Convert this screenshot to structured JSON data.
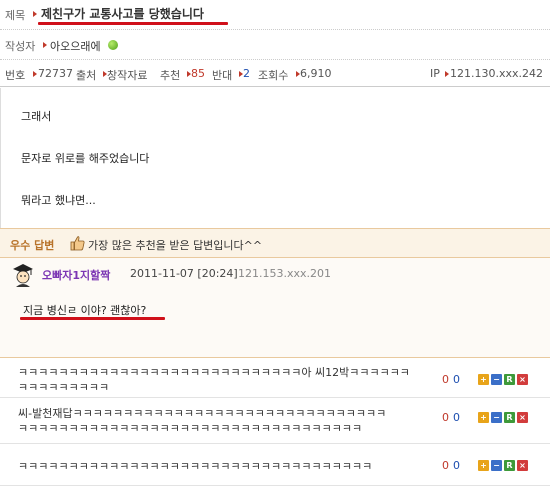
{
  "header": {
    "title_label": "제목",
    "title": "제친구가 교통사고를 당했습니다",
    "author_label": "작성자",
    "author": "아오으래에"
  },
  "meta": {
    "no_label": "번호",
    "no_value": "72737",
    "source_label": "출처",
    "source_value": "창작자료",
    "recommend_label": "추천",
    "recommend_value": "85",
    "oppose_label": "반대",
    "oppose_value": "2",
    "views_label": "조회수",
    "views_value": "6,910",
    "ip_label": "IP",
    "ip_value": "121.130.xxx.242"
  },
  "content": {
    "lines": [
      "그래서",
      "문자로 위로를 해주었습니다",
      "뭐라고 했냐면..."
    ]
  },
  "best_answer": {
    "label": "우수 답변",
    "description": "가장 많은 추천을 받은 답변입니다^^",
    "author": "오빠자1지할짝",
    "date": "2011-11-07 [20:24]",
    "ip": "121.153.xxx.201",
    "comment": "지금 병신ㄹ 이야? 괜찮아?"
  },
  "comments": [
    {
      "lines": [
        "ㅋㅋㅋㅋㅋㅋㅋㅋㅋㅋㅋㅋㅋㅋㅋㅋㅋㅋㅋㅋㅋㅋㅋㅋㅋㅋㅋㅋ아 씨12박ㅋㅋㅋㅋㅋㅋ",
        "ㅋㅋㅋㅋㅋㅋㅋㅋㅋ"
      ],
      "up": "0",
      "down": "0"
    },
    {
      "lines": [
        "씨-발천재답ㅋㅋㅋㅋㅋㅋㅋㅋㅋㅋㅋㅋㅋㅋㅋㅋㅋㅋㅋㅋㅋㅋㅋㅋㅋㅋㅋㅋㅋㅋㅋ",
        "ㅋㅋㅋㅋㅋㅋㅋㅋㅋㅋㅋㅋㅋㅋㅋㅋㅋㅋㅋㅋㅋㅋㅋㅋㅋㅋㅋㅋㅋㅋㅋㅋㅋㅋ"
      ],
      "up": "0",
      "down": "0"
    },
    {
      "lines": [
        "ㅋㅋㅋㅋㅋㅋㅋㅋㅋㅋㅋㅋㅋㅋㅋㅋㅋㅋㅋㅋㅋㅋㅋㅋㅋㅋㅋㅋㅋㅋㅋㅋㅋㅋㅋ"
      ],
      "up": "0",
      "down": "0"
    }
  ],
  "comment_buttons": {
    "plus": "+",
    "minus": "−",
    "reply": "R",
    "delete": "×"
  },
  "colors": {
    "accent_red": "#d0101a",
    "best_bg": "#fbf3e6",
    "author_purple": "#7b35b3"
  }
}
